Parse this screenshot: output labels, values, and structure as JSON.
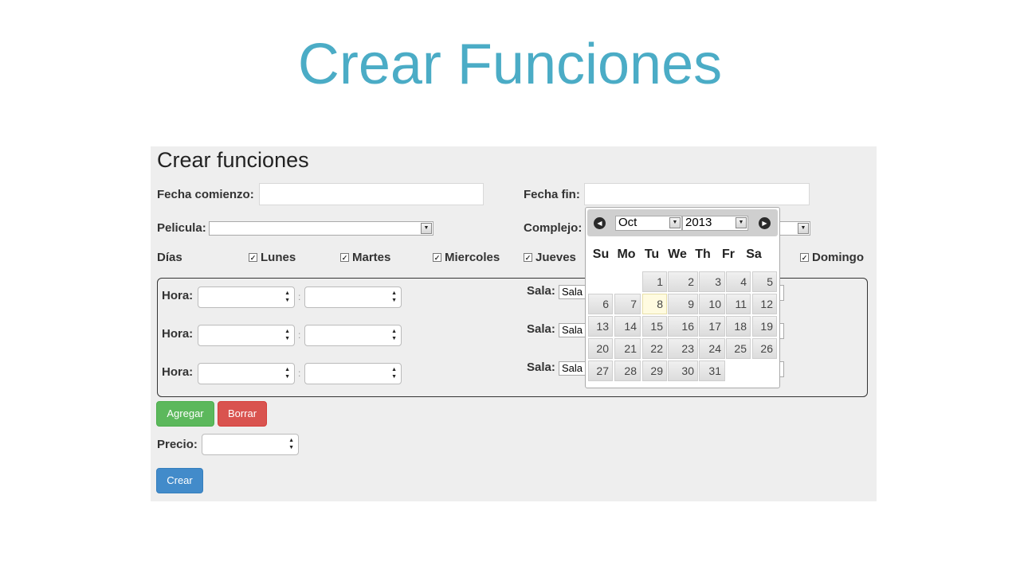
{
  "slide": {
    "title": "Crear Funciones"
  },
  "form": {
    "title": "Crear funciones",
    "fecha_comienzo_label": "Fecha comienzo:",
    "fecha_fin_label": "Fecha fin:",
    "pelicula_label": "Pelicula:",
    "complejo_label": "Complejo:",
    "dias_label": "Días",
    "days": [
      "Lunes",
      "Martes",
      "Miercoles",
      "Jueves",
      "Domingo"
    ],
    "hora_label": "Hora:",
    "sala_label": "Sala:",
    "sala_value": "Sala",
    "time_separator": ":",
    "agregar": "Agregar",
    "borrar": "Borrar",
    "precio_label": "Precio:",
    "crear": "Crear"
  },
  "datepicker": {
    "month": "Oct",
    "year": "2013",
    "weekdays": [
      "Su",
      "Mo",
      "Tu",
      "We",
      "Th",
      "Fr",
      "Sa"
    ],
    "days": [
      "1",
      "2",
      "3",
      "4",
      "5",
      "6",
      "7",
      "8",
      "9",
      "10",
      "11",
      "12",
      "13",
      "14",
      "15",
      "16",
      "17",
      "18",
      "19",
      "20",
      "21",
      "22",
      "23",
      "24",
      "25",
      "26",
      "27",
      "28",
      "29",
      "30",
      "31"
    ],
    "first_weekday_index": 2,
    "highlighted_day": "8"
  },
  "colors": {
    "title": "#4bacc6",
    "green": "#5cb85c",
    "red": "#d9534f",
    "blue": "#428bca"
  }
}
